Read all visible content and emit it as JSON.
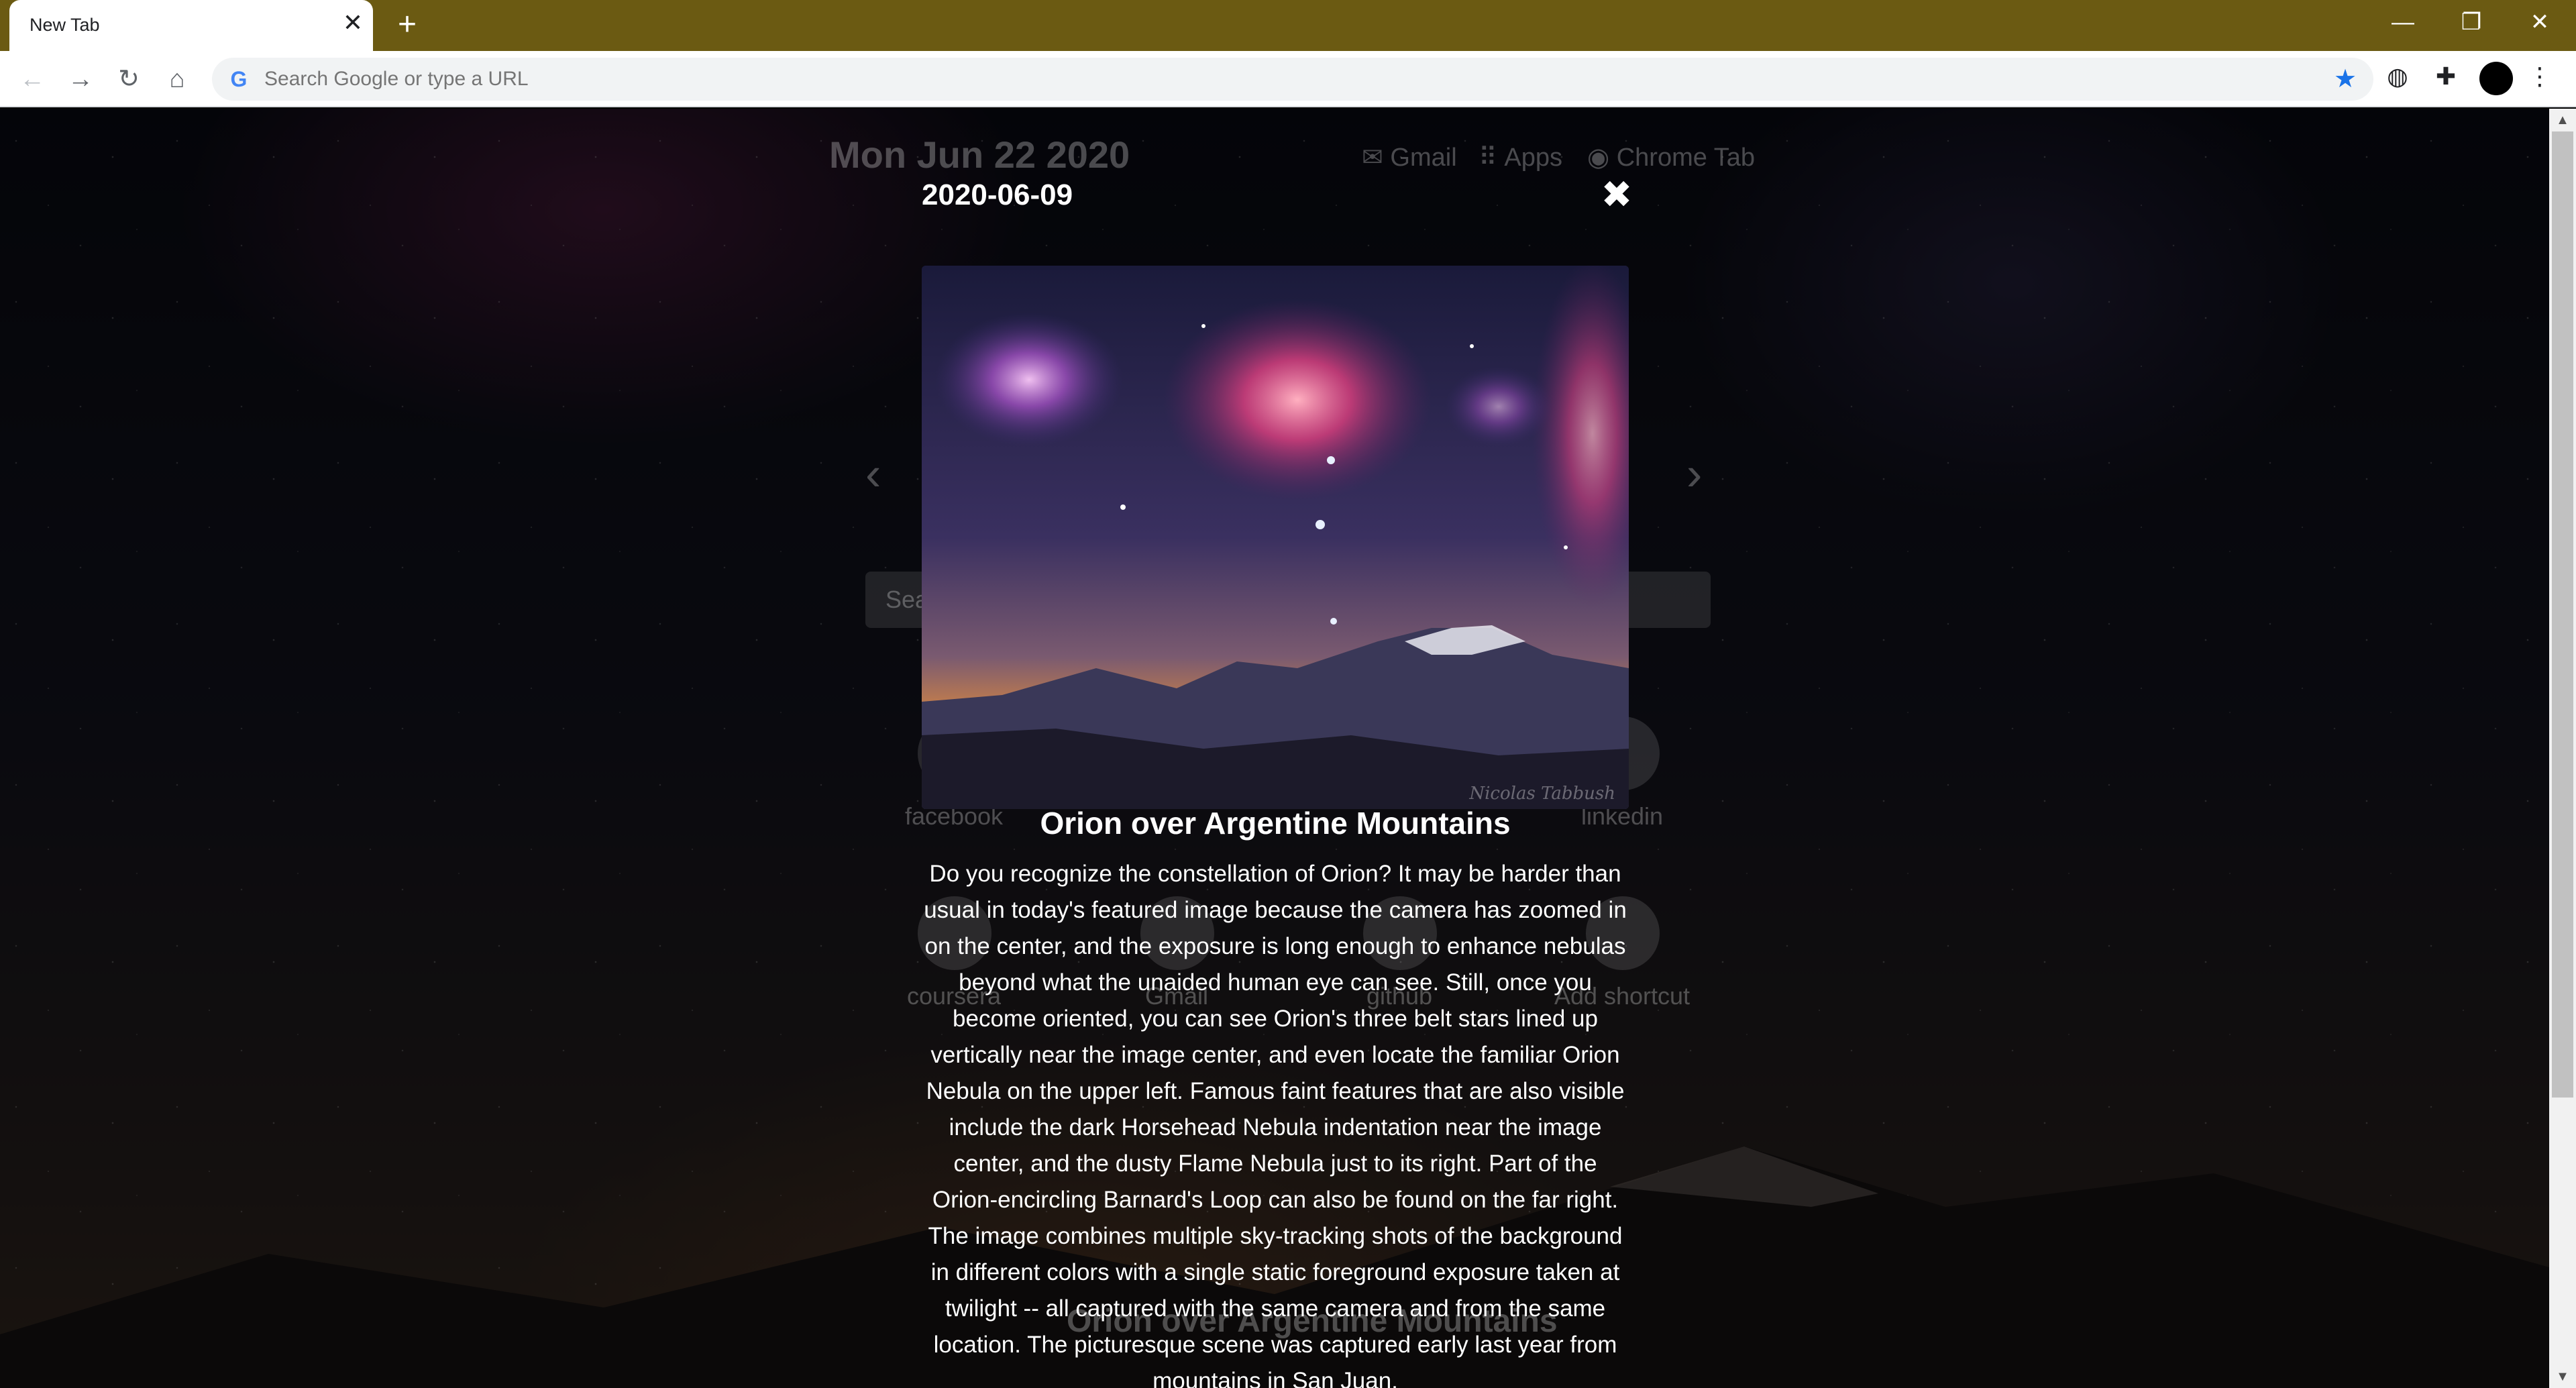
{
  "browser": {
    "tab_title": "New Tab",
    "tab_close_glyph": "✕",
    "new_tab_glyph": "+",
    "window_controls": {
      "minimize": "—",
      "restore": "❐",
      "close": "✕"
    },
    "nav": {
      "back": "←",
      "forward": "→",
      "reload": "↻",
      "home": "⌂"
    },
    "omnibox_placeholder": "Search Google or type a URL",
    "google_glyph": "G",
    "bookmark_star": "★",
    "toolbar_icons": {
      "globe": "◍",
      "extensions": "✚",
      "menu": "⋮"
    },
    "tabstrip_color": "#6b5a12"
  },
  "background_page": {
    "date": "Mon Jun 22 2020",
    "links": [
      {
        "icon": "✉",
        "label": "Gmail"
      },
      {
        "icon": "⠿",
        "label": "Apps"
      },
      {
        "icon": "◉",
        "label": "Chrome Tab"
      }
    ],
    "prev_arrow": "‹",
    "next_arrow": "›",
    "search_placeholder": "Sea",
    "shortcuts_row1": [
      {
        "label": "facebook"
      },
      {
        "label": "linkedin"
      }
    ],
    "shortcuts_row2": [
      {
        "label": "coursera"
      },
      {
        "label": "Gmail"
      },
      {
        "label": "github"
      },
      {
        "label": "Add shortcut"
      }
    ],
    "caption": "Orion over Argentine Mountains"
  },
  "modal": {
    "date": "2020-06-09",
    "close_glyph": "✖",
    "title": "Orion over Argentine Mountains",
    "watermark": "Nicolas Tabbush",
    "description": "Do you recognize the constellation of Orion? It may be harder than usual in today's featured image because the camera has zoomed in on the center, and the exposure is long enough to enhance nebulas beyond what the unaided human eye can see. Still, once you become oriented, you can see Orion's three belt stars lined up vertically near the image center, and even locate the familiar Orion Nebula on the upper left. Famous faint features that are also visible include the dark Horsehead Nebula indentation near the image center, and the dusty Flame Nebula just to its right. Part of the Orion-encircling Barnard's Loop can also be found on the far right. The image combines multiple sky-tracking shots of the background in different colors with a single static foreground exposure taken at twilight -- all captured with the same camera and from the same location. The picturesque scene was captured early last year from mountains in San Juan,"
  },
  "scrollbar": {
    "up": "▲",
    "down": "▼"
  }
}
